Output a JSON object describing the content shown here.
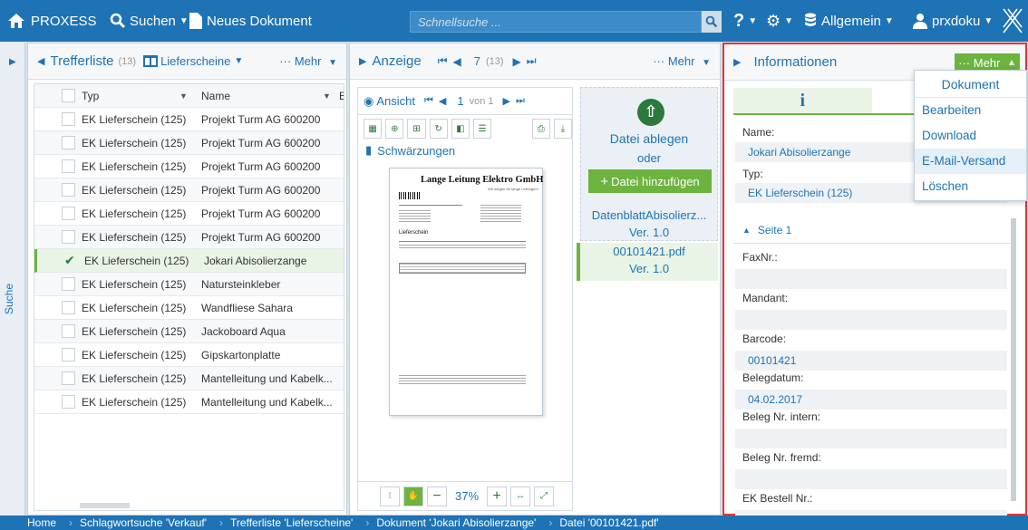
{
  "app": {
    "brand": "PROXESS",
    "search_menu": "Suchen",
    "new_doc": "Neues Dokument",
    "quick_search_placeholder": "Schnellsuche ...",
    "help": "?",
    "workspace": "Allgemein",
    "user": "prxdoku"
  },
  "colors": {
    "primary": "#1e73b5",
    "accent_green": "#6db33f",
    "highlight_border": "#e53333"
  },
  "sidebar": {
    "label": "Suche"
  },
  "results": {
    "title": "Trefferliste",
    "count": "(13)",
    "filter": "Lieferscheine",
    "mehr": "Mehr",
    "col_typ": "Typ",
    "col_name": "Name",
    "col_b": "B",
    "rows": [
      {
        "typ": "EK Lieferschein (125)",
        "name": "Projekt Turm AG 600200"
      },
      {
        "typ": "EK Lieferschein (125)",
        "name": "Projekt Turm AG 600200"
      },
      {
        "typ": "EK Lieferschein (125)",
        "name": "Projekt Turm AG 600200"
      },
      {
        "typ": "EK Lieferschein (125)",
        "name": "Projekt Turm AG 600200"
      },
      {
        "typ": "EK Lieferschein (125)",
        "name": "Projekt Turm AG 600200"
      },
      {
        "typ": "EK Lieferschein (125)",
        "name": "Projekt Turm AG 600200"
      },
      {
        "typ": "EK Lieferschein (125)",
        "name": "Jokari Abisolierzange"
      },
      {
        "typ": "EK Lieferschein (125)",
        "name": "Natursteinkleber"
      },
      {
        "typ": "EK Lieferschein (125)",
        "name": "Wandfliese Sahara"
      },
      {
        "typ": "EK Lieferschein (125)",
        "name": "Jackoboard Aqua"
      },
      {
        "typ": "EK Lieferschein (125)",
        "name": "Gipskartonplatte"
      },
      {
        "typ": "EK Lieferschein (125)",
        "name": "Mantelleitung und Kabelk..."
      },
      {
        "typ": "EK Lieferschein (125)",
        "name": "Mantelleitung und Kabelk..."
      }
    ]
  },
  "viewer": {
    "title": "Anzeige",
    "page": "7",
    "page_total": "(13)",
    "mehr": "Mehr",
    "view_tab": "Ansicht",
    "view_page": "1",
    "view_of": "von 1",
    "redactions": "Schwärzungen",
    "zoom": "37%",
    "drop_text": "Datei ablegen",
    "or": "oder",
    "add_file": "Datei hinzufügen",
    "files": [
      {
        "name": "DatenblattAbisolierz...",
        "ver": "Ver. 1.0"
      },
      {
        "name": "00101421.pdf",
        "ver": "Ver. 1.0"
      }
    ],
    "doc_preview": {
      "company": "Lange Leitung Elektro GmbH",
      "tagline": "Wir sorgen für lange Leitungen!",
      "heading": "Lieferschein"
    }
  },
  "info": {
    "title": "Informationen",
    "mehr": "Mehr",
    "name_label": "Name:",
    "name_val": "Jokari Abisolierzange",
    "typ_label": "Typ:",
    "typ_val": "EK Lieferschein (125)",
    "section": "Seite 1",
    "fields": [
      {
        "label": "FaxNr.:",
        "value": ""
      },
      {
        "label": "Mandant:",
        "value": ""
      },
      {
        "label": "Barcode:",
        "value": "00101421"
      },
      {
        "label": "Belegdatum:",
        "value": "04.02.2017"
      },
      {
        "label": "Beleg Nr. intern:",
        "value": ""
      },
      {
        "label": "Beleg Nr. fremd:",
        "value": ""
      },
      {
        "label": "EK Bestell Nr.:",
        "value": ""
      }
    ]
  },
  "dropdown": {
    "header": "Dokument",
    "items": [
      "Bearbeiten",
      "Download",
      "E-Mail-Versand",
      "Löschen"
    ]
  },
  "breadcrumb": [
    "Home",
    "Schlagwortsuche 'Verkauf'",
    "Trefferliste 'Lieferscheine'",
    "Dokument 'Jokari Abisolierzange'",
    "Datei '00101421.pdf'"
  ]
}
